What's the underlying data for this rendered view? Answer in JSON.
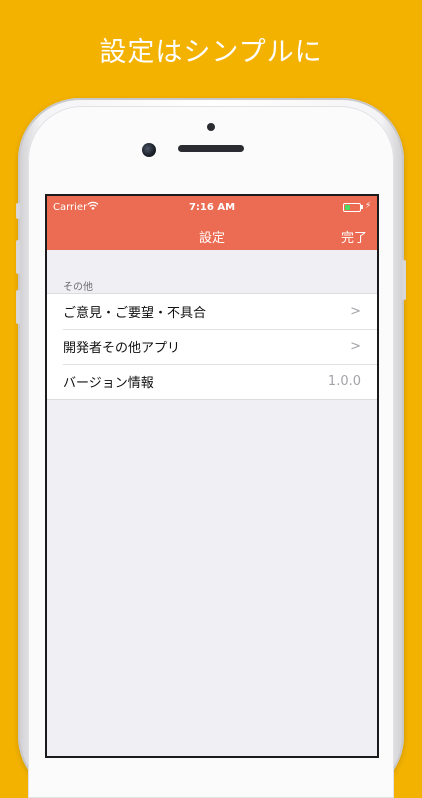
{
  "promo": {
    "title": "設定はシンプルに"
  },
  "status_bar": {
    "carrier": "Carrier",
    "time": "7:16 AM"
  },
  "navbar": {
    "title": "設定",
    "done_label": "完了"
  },
  "section": {
    "header": "その他",
    "rows": [
      {
        "label": "ご意見・ご要望・不具合",
        "accessory": ">"
      },
      {
        "label": "開発者その他アプリ",
        "accessory": ">"
      },
      {
        "label": "バージョン情報",
        "value": "1.0.0"
      }
    ]
  },
  "colors": {
    "background": "#F3B200",
    "navbar": "#EC6C53",
    "list_background": "#EFEFF4"
  }
}
